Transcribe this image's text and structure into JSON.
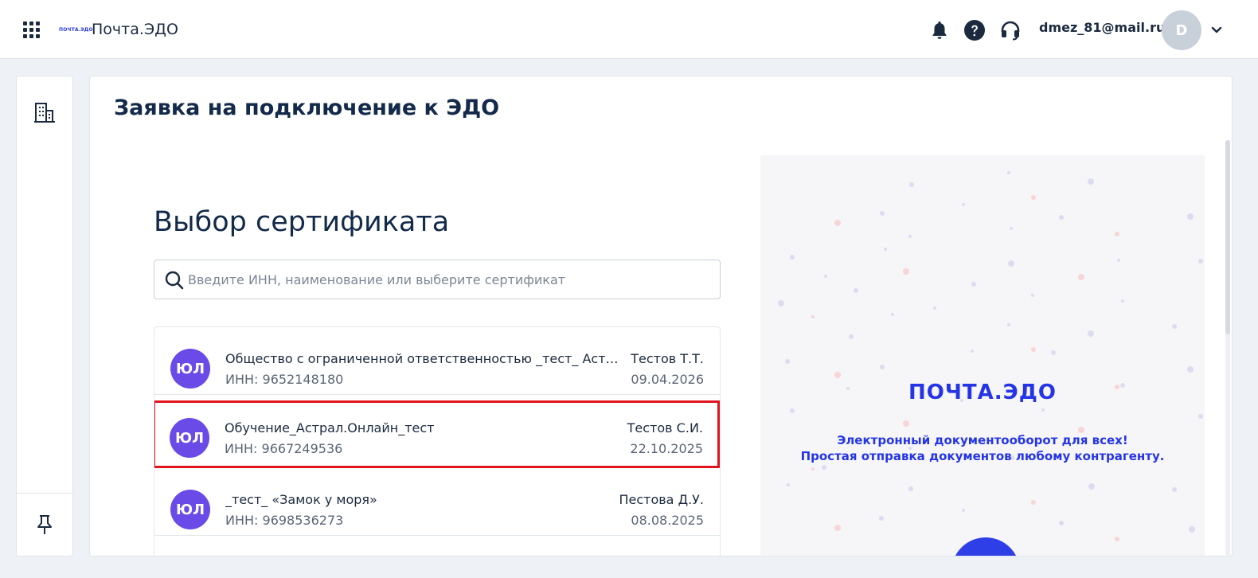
{
  "header": {
    "app_title": "Почта.ЭДО",
    "logo_small": "ПОЧТА.ЭДО",
    "user_email": "dmez_81@mail.ru",
    "avatar_letter": "D",
    "icons": [
      "apps-grid-icon",
      "bell-icon",
      "help-icon",
      "headset-icon",
      "chevron-down-icon"
    ]
  },
  "sidebar": {
    "icons": [
      "building-icon",
      "pin-icon"
    ]
  },
  "page": {
    "title": "Заявка на подключение к ЭДО",
    "section_title": "Выбор сертификата",
    "search_placeholder": "Введите ИНН, наименование или выберите сертификат"
  },
  "certificates": [
    {
      "badge": "ЮЛ",
      "name": "Общество с ограниченной ответственностью _тест_ Астрал-Онлайн",
      "inn": "ИНН: 9652148180",
      "owner": "Тестов Т.Т.",
      "date": "09.04.2026",
      "selected": false
    },
    {
      "badge": "ЮЛ",
      "name": "Обучение_Астрал.Онлайн_тест",
      "inn": "ИНН: 9667249536",
      "owner": "Тестов С.И.",
      "date": "22.10.2025",
      "selected": true
    },
    {
      "badge": "ЮЛ",
      "name": "_тест_ «Замок у моря»",
      "inn": "ИНН: 9698536273",
      "owner": "Пестова Д.У.",
      "date": "08.08.2025",
      "selected": false
    }
  ],
  "promo": {
    "logo": "ПОЧТА.ЭДО",
    "line1": "Электронный документооборот для всех!",
    "line2": "Простая отправка документов любому контрагенту."
  },
  "colors": {
    "accent": "#2535e6",
    "badge": "#6b4be8",
    "selection": "#e0141d",
    "text": "#1b2a3f"
  }
}
